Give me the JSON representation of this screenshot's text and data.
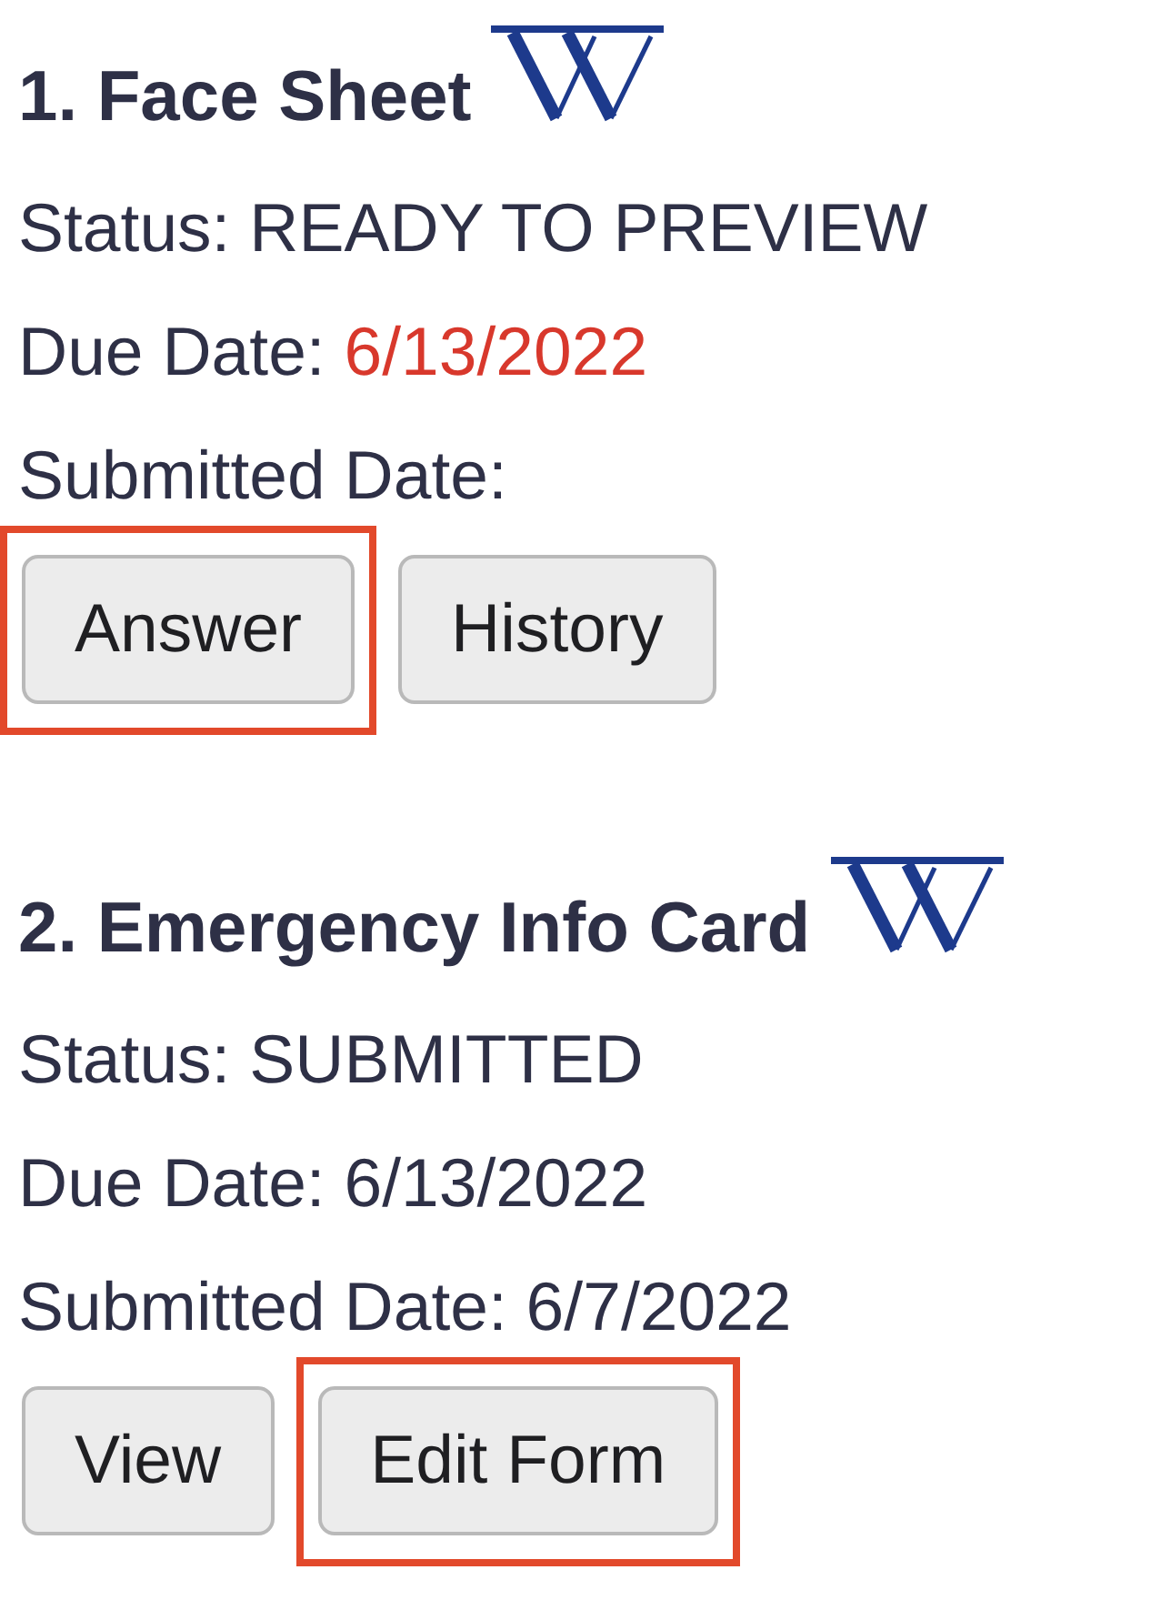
{
  "forms": [
    {
      "title": "1. Face Sheet",
      "status": {
        "label": "Status:",
        "value": "READY TO PREVIEW"
      },
      "due_date": {
        "label": "Due Date:",
        "value": "6/13/2022",
        "alert": true
      },
      "submitted_date": {
        "label": "Submitted Date:"
      },
      "buttons": [
        {
          "label": "Answer",
          "highlighted": true
        },
        {
          "label": "History",
          "highlighted": false
        }
      ]
    },
    {
      "title": "2. Emergency Info Card",
      "status": {
        "label": "Status:",
        "value": "SUBMITTED"
      },
      "due_date": {
        "label": "Due Date:",
        "value": "6/13/2022",
        "alert": false
      },
      "submitted_date": {
        "label": "Submitted Date:",
        "value": "6/7/2022"
      },
      "buttons": [
        {
          "label": "View",
          "highlighted": false
        },
        {
          "label": "Edit Form",
          "highlighted": true
        }
      ]
    }
  ]
}
